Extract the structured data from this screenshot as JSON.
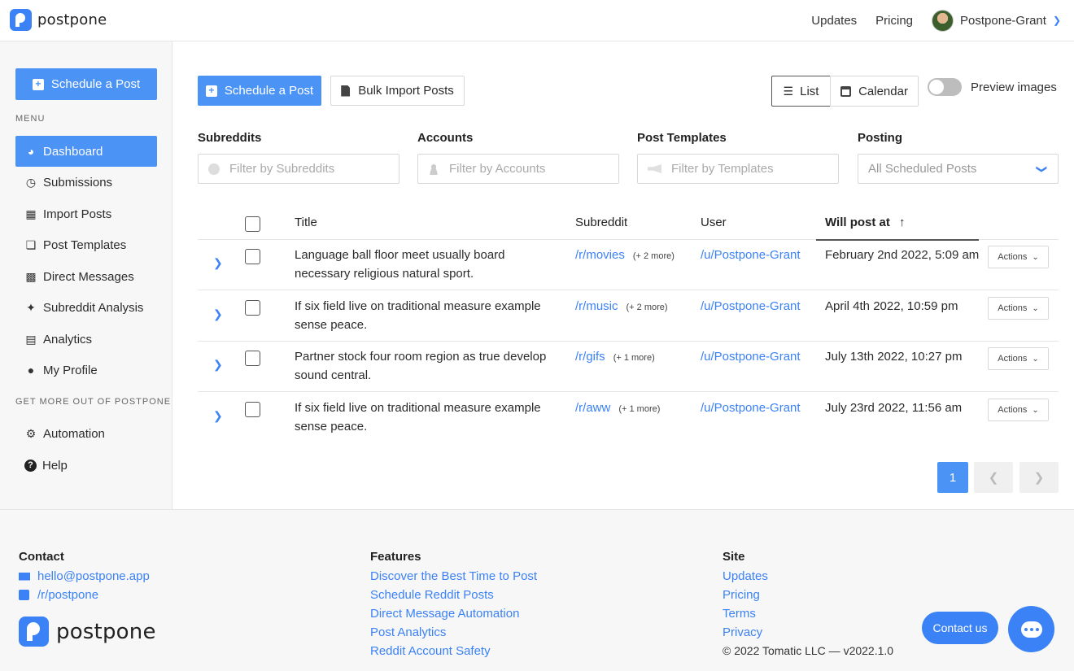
{
  "brand": {
    "name": "postpone"
  },
  "topnav": {
    "updates": "Updates",
    "pricing": "Pricing",
    "user": "Postpone-Grant"
  },
  "sidebar": {
    "schedule_button": "Schedule a Post",
    "menu_label": "MENU",
    "items": [
      {
        "label": "Dashboard",
        "icon": "gauge-icon",
        "active": true
      },
      {
        "label": "Submissions",
        "icon": "clock-icon"
      },
      {
        "label": "Import Posts",
        "icon": "csv-file-icon"
      },
      {
        "label": "Post Templates",
        "icon": "copy-icon"
      },
      {
        "label": "Direct Messages",
        "icon": "chat-icon"
      },
      {
        "label": "Subreddit Analysis",
        "icon": "telescope-icon"
      },
      {
        "label": "Analytics",
        "icon": "bar-chart-icon"
      },
      {
        "label": "My Profile",
        "icon": "user-icon"
      }
    ],
    "more_label": "GET MORE OUT OF POSTPONE",
    "more_items": [
      {
        "label": "Automation",
        "icon": "gear-icon"
      },
      {
        "label": "Help",
        "icon": "question-icon"
      }
    ]
  },
  "toolbar": {
    "schedule": "Schedule a Post",
    "bulk_import": "Bulk Import Posts",
    "view_list": "List",
    "view_calendar": "Calendar",
    "preview_images": "Preview images"
  },
  "filters": {
    "subreddits": {
      "label": "Subreddits",
      "placeholder": "Filter by Subreddits"
    },
    "accounts": {
      "label": "Accounts",
      "placeholder": "Filter by Accounts"
    },
    "templates": {
      "label": "Post Templates",
      "placeholder": "Filter by Templates"
    },
    "posting": {
      "label": "Posting",
      "value": "All Scheduled Posts"
    }
  },
  "table": {
    "columns": {
      "title": "Title",
      "subreddit": "Subreddit",
      "user": "User",
      "will_post_at": "Will post at"
    },
    "actions_label": "Actions",
    "rows": [
      {
        "title": "Language ball floor meet usually board necessary religious natural sport.",
        "subreddit": "/r/movies",
        "more": "(+ 2 more)",
        "user": "/u/Postpone-Grant",
        "date": "February 2nd 2022, 5:09 am"
      },
      {
        "title": "If six field live on traditional measure example sense peace.",
        "subreddit": "/r/music",
        "more": "(+ 2 more)",
        "user": "/u/Postpone-Grant",
        "date": "April 4th 2022, 10:59 pm"
      },
      {
        "title": "Partner stock four room region as true develop sound central.",
        "subreddit": "/r/gifs",
        "more": "(+ 1 more)",
        "user": "/u/Postpone-Grant",
        "date": "July 13th 2022, 10:27 pm"
      },
      {
        "title": "If six field live on traditional measure example sense peace.",
        "subreddit": "/r/aww",
        "more": "(+ 1 more)",
        "user": "/u/Postpone-Grant",
        "date": "July 23rd 2022, 11:56 am"
      }
    ]
  },
  "pagination": {
    "current": "1"
  },
  "footer": {
    "contact": {
      "heading": "Contact",
      "email": "hello@postpone.app",
      "reddit": "/r/postpone"
    },
    "features": {
      "heading": "Features",
      "links": [
        "Discover the Best Time to Post",
        "Schedule Reddit Posts",
        "Direct Message Automation",
        "Post Analytics",
        "Reddit Account Safety"
      ]
    },
    "site": {
      "heading": "Site",
      "links": [
        "Updates",
        "Pricing",
        "Terms",
        "Privacy"
      ],
      "copyright": "© 2022 Tomatic LLC — v2022.1.0"
    },
    "contact_us": "Contact us"
  },
  "colors": {
    "accent": "#4b93f5",
    "link": "#3b82f6"
  }
}
